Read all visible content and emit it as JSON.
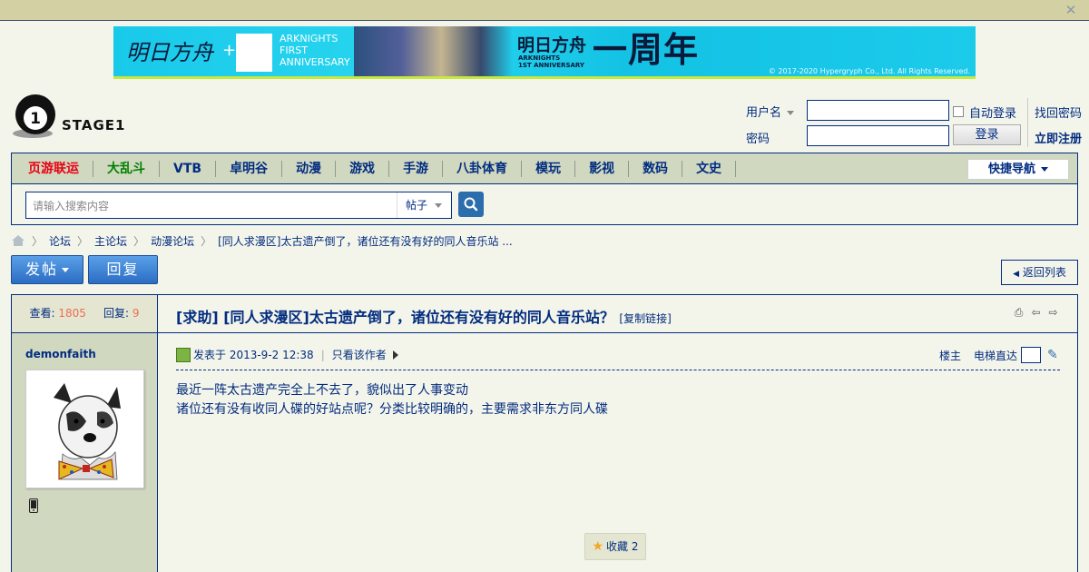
{
  "banner": {
    "title_left": "明日方舟",
    "plus": "+",
    "ak_line1": "ARKNIGHTS",
    "ak_line2": "FIRST",
    "ak_line3": "ANNIVERSARY",
    "title_mid": "明日方舟",
    "sub_mid_1": "ARKNIGHTS",
    "sub_mid_2": "1ST ANNIVERSARY",
    "title_right": "一周年",
    "copyright": "© 2017-2020 Hypergryph Co., Ltd. All Rights Reserved."
  },
  "site": {
    "logo_text": "STAGE1"
  },
  "login": {
    "username_label": "用户名",
    "password_label": "密码",
    "auto_login": "自动登录",
    "login_button": "登录",
    "find_password": "找回密码",
    "register": "立即注册"
  },
  "nav": {
    "items": [
      {
        "label": "页游联运",
        "color": "#e60012"
      },
      {
        "label": "大乱斗",
        "color": "#008000"
      },
      {
        "label": "VTB"
      },
      {
        "label": "卓明谷"
      },
      {
        "label": "动漫"
      },
      {
        "label": "游戏"
      },
      {
        "label": "手游"
      },
      {
        "label": "八卦体育"
      },
      {
        "label": "模玩"
      },
      {
        "label": "影视"
      },
      {
        "label": "数码"
      },
      {
        "label": "文史"
      }
    ],
    "quick_nav": "快捷导航"
  },
  "search": {
    "placeholder": "请输入搜索内容",
    "type": "帖子"
  },
  "breadcrumb": [
    "论坛",
    "主论坛",
    "动漫论坛",
    "[同人求漫区]太古遗产倒了，诸位还有没有好的同人音乐站 ..."
  ],
  "actions": {
    "post_button": "发帖",
    "reply_button": "回复",
    "back_list": "返回列表"
  },
  "thread": {
    "views_label": "查看:",
    "views": "1805",
    "replies_label": "回复:",
    "replies": "9",
    "title": "[求助] [同人求漫区]太古遗产倒了，诸位还有没有好的同人音乐站？",
    "copy_link": "[复制链接]"
  },
  "post": {
    "author": "demonfaith",
    "posted_at": "发表于 2013-9-2 12:38",
    "only_author": "只看该作者",
    "floor": "楼主",
    "elevator": "电梯直达",
    "lines": [
      "最近一阵太古遗产完全上不去了，貌似出了人事变动",
      "诸位还有没有收同人碟的好站点呢？分类比较明确的，主要需求非东方同人碟"
    ],
    "favorite": "收藏 2"
  },
  "colors": {
    "accent": "#022c80",
    "background": "#f4f5ea",
    "nav_bar": "#d1d8c0",
    "count_highlight": "#f26c4f"
  }
}
